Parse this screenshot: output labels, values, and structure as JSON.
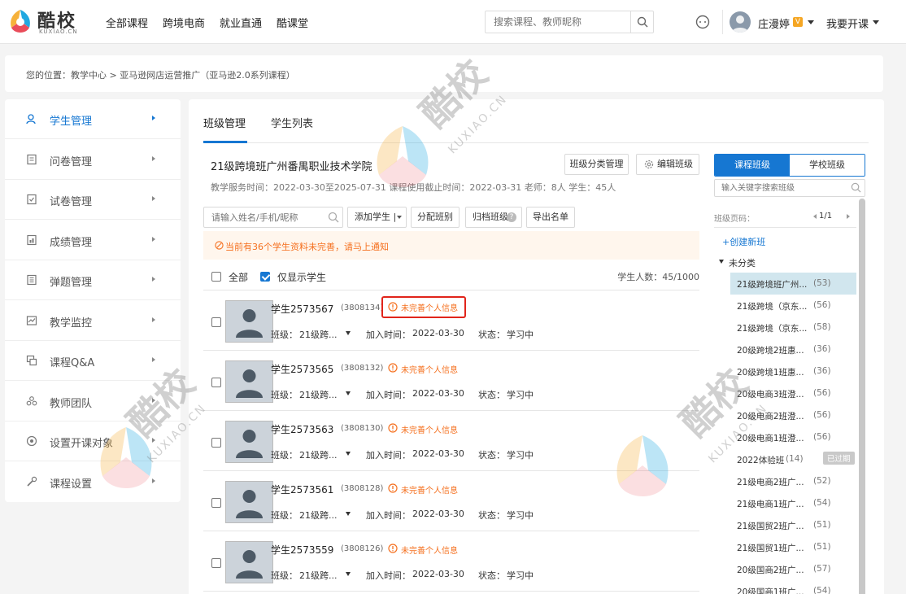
{
  "brand": {
    "name": "酷校",
    "sub": "KUXIAO.CN"
  },
  "nav": {
    "links": [
      "全部课程",
      "跨境电商",
      "就业直通",
      "酷课堂"
    ]
  },
  "search": {
    "placeholder": "搜索课程、教师昵称"
  },
  "user": {
    "name": "庄漫婷",
    "badge": "V",
    "open_course": "我要开课"
  },
  "breadcrumb": "您的位置：教学中心 > 亚马逊网店运营推广（亚马逊2.0系列课程）",
  "sidebar": {
    "items": [
      {
        "label": "学生管理",
        "icon": "students-icon",
        "active": true
      },
      {
        "label": "问卷管理",
        "icon": "survey-icon"
      },
      {
        "label": "试卷管理",
        "icon": "exam-icon"
      },
      {
        "label": "成绩管理",
        "icon": "grades-icon"
      },
      {
        "label": "弹题管理",
        "icon": "popup-question-icon"
      },
      {
        "label": "教学监控",
        "icon": "monitor-icon"
      },
      {
        "label": "课程Q&A",
        "icon": "qa-icon"
      },
      {
        "label": "教师团队",
        "icon": "team-icon"
      },
      {
        "label": "设置开课对象",
        "icon": "target-icon"
      },
      {
        "label": "课程设置",
        "icon": "settings-icon"
      }
    ]
  },
  "tabs": [
    "班级管理",
    "学生列表"
  ],
  "class_info": {
    "title": "21级跨境班广州番禺职业技术学院",
    "details": "教学服务时间：2022-03-30至2025-07-31 课程使用截止时间：2022-03-31 老师：8人 学生：45人"
  },
  "buttons": {
    "sort": "班级分类管理",
    "edit": "编辑班级",
    "add_student": "添加学生 |",
    "assign": "分配班别",
    "archive": "归档班级",
    "archive_help": "?",
    "export": "导出名单"
  },
  "toolbar": {
    "search_placeholder": "请输入姓名/手机/昵称"
  },
  "warning": "当前有36个学生资料未完善，请马上通知",
  "list_header": {
    "all": "全部",
    "students_only": "仅显示学生",
    "count": "学生人数：45/1000"
  },
  "students": [
    {
      "name": "学生2573567",
      "id": "(3808134)",
      "status_text": "未完善个人信息",
      "class_label": "班级：",
      "class": "21级跨...",
      "join_label": "加入时间：",
      "join_date": "2022-03-30",
      "state_label": "状态：",
      "state": "学习中",
      "highlighted": true
    },
    {
      "name": "学生2573565",
      "id": "(3808132)",
      "status_text": "未完善个人信息",
      "class_label": "班级：",
      "class": "21级跨...",
      "join_label": "加入时间：",
      "join_date": "2022-03-30",
      "state_label": "状态：",
      "state": "学习中"
    },
    {
      "name": "学生2573563",
      "id": "(3808130)",
      "status_text": "未完善个人信息",
      "class_label": "班级：",
      "class": "21级跨...",
      "join_label": "加入时间：",
      "join_date": "2022-03-30",
      "state_label": "状态：",
      "state": "学习中"
    },
    {
      "name": "学生2573561",
      "id": "(3808128)",
      "status_text": "未完善个人信息",
      "class_label": "班级：",
      "class": "21级跨...",
      "join_label": "加入时间：",
      "join_date": "2022-03-30",
      "state_label": "状态：",
      "state": "学习中"
    },
    {
      "name": "学生2573559",
      "id": "(3808126)",
      "status_text": "未完善个人信息",
      "class_label": "班级：",
      "class": "21级跨...",
      "join_label": "加入时间：",
      "join_date": "2022-03-30",
      "state_label": "状态：",
      "state": "学习中"
    }
  ],
  "right_panel": {
    "tabs": [
      "课程班级",
      "学校班级"
    ],
    "search_placeholder": "输入关键字搜索班级",
    "pager_label": "班级页码：",
    "pager": "1/1",
    "create": "+创建新班",
    "group": "未分类",
    "classes": [
      {
        "name": "21级跨境班广州...",
        "count": "(53)",
        "selected": true
      },
      {
        "name": "21级跨境（京东...",
        "count": "(56)"
      },
      {
        "name": "21级跨境（京东...",
        "count": "(58)"
      },
      {
        "name": "20级跨境2班惠...",
        "count": "(36)"
      },
      {
        "name": "20级跨境1班惠...",
        "count": "(36)"
      },
      {
        "name": "20级电商3班澄...",
        "count": "(56)"
      },
      {
        "name": "20级电商2班澄...",
        "count": "(56)"
      },
      {
        "name": "20级电商1班澄...",
        "count": "(56)"
      },
      {
        "name": "2022体验班",
        "count": "(14)",
        "badge": "已过期"
      },
      {
        "name": "21级电商2班广...",
        "count": "(52)"
      },
      {
        "name": "21级电商1班广...",
        "count": "(54)"
      },
      {
        "name": "21级国贸2班广...",
        "count": "(51)"
      },
      {
        "name": "21级国贸1班广...",
        "count": "(51)"
      },
      {
        "name": "20级国商2班广...",
        "count": "(57)"
      },
      {
        "name": "20级国商1班广...",
        "count": "(54)"
      }
    ]
  },
  "watermark": {
    "text": "酷校",
    "sub": "KUXIAO.CN"
  },
  "colors": {
    "primary": "#1677d2",
    "warning": "#f5701f",
    "highlight_border": "#e1251b",
    "selected_bg": "#d1e6ee"
  }
}
